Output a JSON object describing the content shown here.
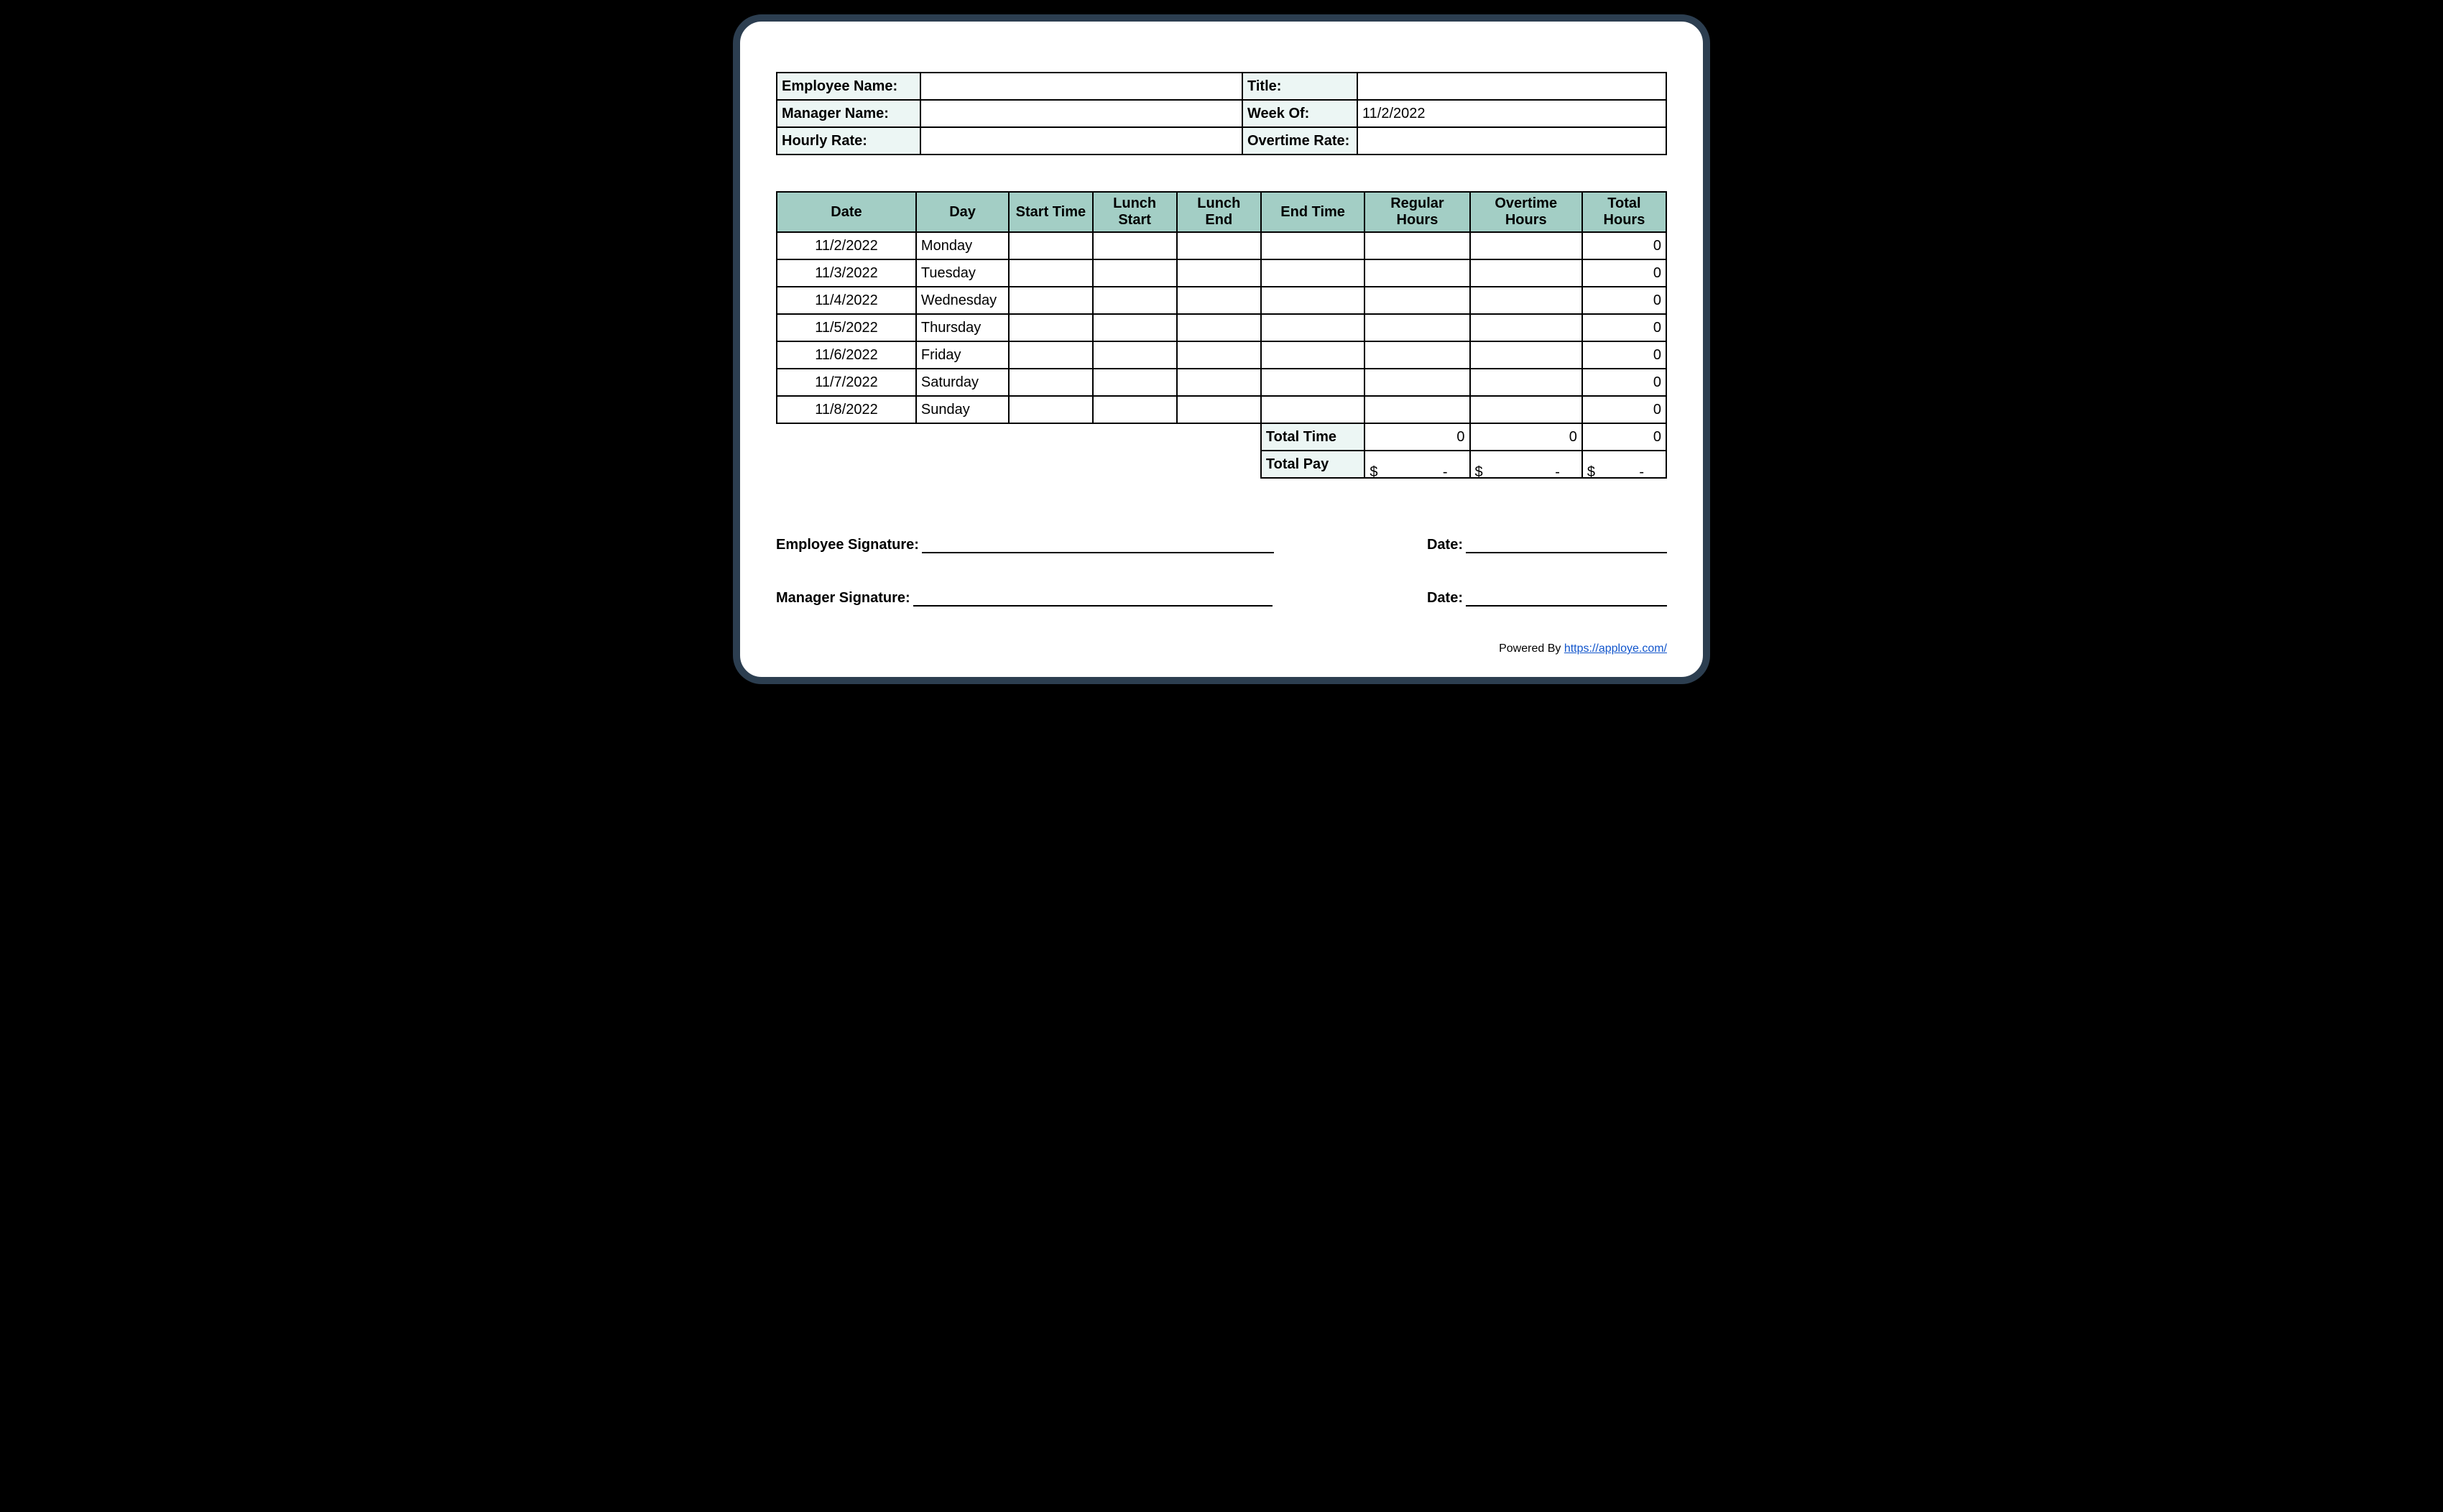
{
  "info": {
    "employee_name_label": "Employee Name:",
    "employee_name": "",
    "title_label": "Title:",
    "title": "",
    "manager_name_label": "Manager Name:",
    "manager_name": "",
    "week_of_label": "Week Of:",
    "week_of": "11/2/2022",
    "hourly_rate_label": "Hourly Rate:",
    "hourly_rate": "",
    "overtime_rate_label": "Overtime Rate:",
    "overtime_rate": ""
  },
  "columns": {
    "date": "Date",
    "day": "Day",
    "start_time": "Start Time",
    "lunch_start": "Lunch Start",
    "lunch_end": "Lunch End",
    "end_time": "End Time",
    "regular_hours": "Regular Hours",
    "overtime_hours": "Overtime Hours",
    "total_hours": "Total Hours"
  },
  "rows": [
    {
      "date": "11/2/2022",
      "day": "Monday",
      "start": "",
      "ls": "",
      "le": "",
      "end": "",
      "reg": "",
      "ot": "",
      "total": "0"
    },
    {
      "date": "11/3/2022",
      "day": "Tuesday",
      "start": "",
      "ls": "",
      "le": "",
      "end": "",
      "reg": "",
      "ot": "",
      "total": "0"
    },
    {
      "date": "11/4/2022",
      "day": "Wednesday",
      "start": "",
      "ls": "",
      "le": "",
      "end": "",
      "reg": "",
      "ot": "",
      "total": "0"
    },
    {
      "date": "11/5/2022",
      "day": "Thursday",
      "start": "",
      "ls": "",
      "le": "",
      "end": "",
      "reg": "",
      "ot": "",
      "total": "0"
    },
    {
      "date": "11/6/2022",
      "day": "Friday",
      "start": "",
      "ls": "",
      "le": "",
      "end": "",
      "reg": "",
      "ot": "",
      "total": "0"
    },
    {
      "date": "11/7/2022",
      "day": "Saturday",
      "start": "",
      "ls": "",
      "le": "",
      "end": "",
      "reg": "",
      "ot": "",
      "total": "0"
    },
    {
      "date": "11/8/2022",
      "day": "Sunday",
      "start": "",
      "ls": "",
      "le": "",
      "end": "",
      "reg": "",
      "ot": "",
      "total": "0"
    }
  ],
  "totals": {
    "total_time_label": "Total Time",
    "total_time_reg": "0",
    "total_time_ot": "0",
    "total_time_total": "0",
    "total_pay_label": "Total Pay",
    "pay_cur": "$",
    "pay_dash": "-"
  },
  "signatures": {
    "employee_sig": "Employee Signature:",
    "manager_sig": "Manager Signature:",
    "date_label": "Date:"
  },
  "footer": {
    "powered_by": "Powered By ",
    "link_text": "https://apploye.com/"
  }
}
